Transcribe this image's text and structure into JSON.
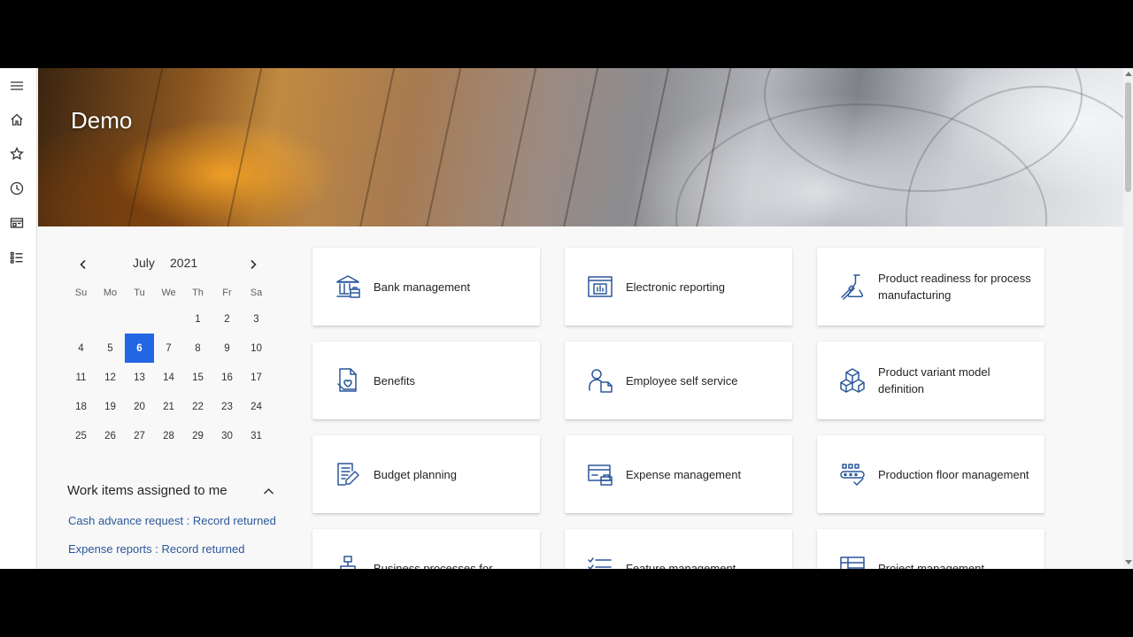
{
  "banner": {
    "title": "Demo"
  },
  "nav": {
    "items": [
      {
        "name": "menu-icon"
      },
      {
        "name": "home-icon"
      },
      {
        "name": "favorites-icon"
      },
      {
        "name": "recent-icon"
      },
      {
        "name": "workspaces-icon"
      },
      {
        "name": "modules-icon"
      }
    ]
  },
  "calendar": {
    "month": "July",
    "year": "2021",
    "weekdays": [
      "Su",
      "Mo",
      "Tu",
      "We",
      "Th",
      "Fr",
      "Sa"
    ],
    "weeks": [
      [
        "",
        "",
        "",
        "",
        "1",
        "2",
        "3"
      ],
      [
        "4",
        "5",
        "6",
        "7",
        "8",
        "9",
        "10"
      ],
      [
        "11",
        "12",
        "13",
        "14",
        "15",
        "16",
        "17"
      ],
      [
        "18",
        "19",
        "20",
        "21",
        "22",
        "23",
        "24"
      ],
      [
        "25",
        "26",
        "27",
        "28",
        "29",
        "30",
        "31"
      ]
    ],
    "selected_day": "6",
    "accent_color": "#2266e3"
  },
  "work_items": {
    "title": "Work items assigned to me",
    "items": [
      {
        "label": "Cash advance request : Record returned"
      },
      {
        "label": "Expense reports : Record returned"
      }
    ]
  },
  "tiles": [
    {
      "label": "Bank management",
      "icon": "bank-icon"
    },
    {
      "label": "Electronic reporting",
      "icon": "report-icon"
    },
    {
      "label": "Product readiness for process manufacturing",
      "icon": "flask-icon"
    },
    {
      "label": "Benefits",
      "icon": "benefits-icon"
    },
    {
      "label": "Employee self service",
      "icon": "employee-icon"
    },
    {
      "label": "Product variant model definition",
      "icon": "cubes-icon"
    },
    {
      "label": "Budget planning",
      "icon": "budget-icon"
    },
    {
      "label": "Expense management",
      "icon": "expense-icon"
    },
    {
      "label": "Production floor management",
      "icon": "production-icon"
    },
    {
      "label": "Business processes for",
      "icon": "hierarchy-icon"
    },
    {
      "label": "Feature management",
      "icon": "checklist-icon"
    },
    {
      "label": "Project management",
      "icon": "project-icon"
    }
  ],
  "colors": {
    "link": "#2b579a",
    "icon_accent": "#2b579a",
    "tile_background": "#ffffff",
    "page_background": "#f8f8f8"
  }
}
